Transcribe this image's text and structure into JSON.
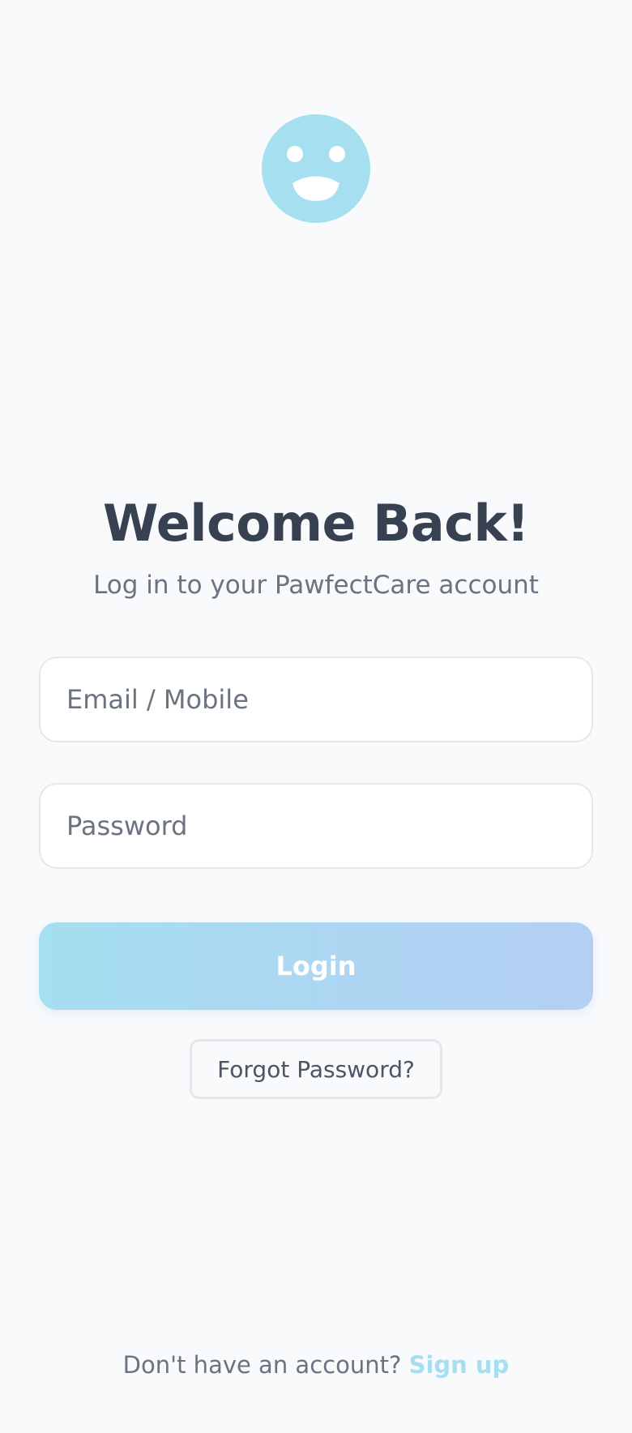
{
  "brand": {
    "logo_icon": "smiley-face-icon",
    "accent_color": "#a5dff0",
    "gradient_end_color": "#b4cff4"
  },
  "header": {
    "title": "Welcome Back!",
    "subtitle": "Log in to your PawfectCare account"
  },
  "form": {
    "email": {
      "placeholder": "Email / Mobile",
      "value": ""
    },
    "password": {
      "placeholder": "Password",
      "value": ""
    },
    "login_label": "Login",
    "forgot_label": "Forgot Password?"
  },
  "footer": {
    "prompt": "Don't have an account?",
    "signup_label": "Sign up"
  }
}
